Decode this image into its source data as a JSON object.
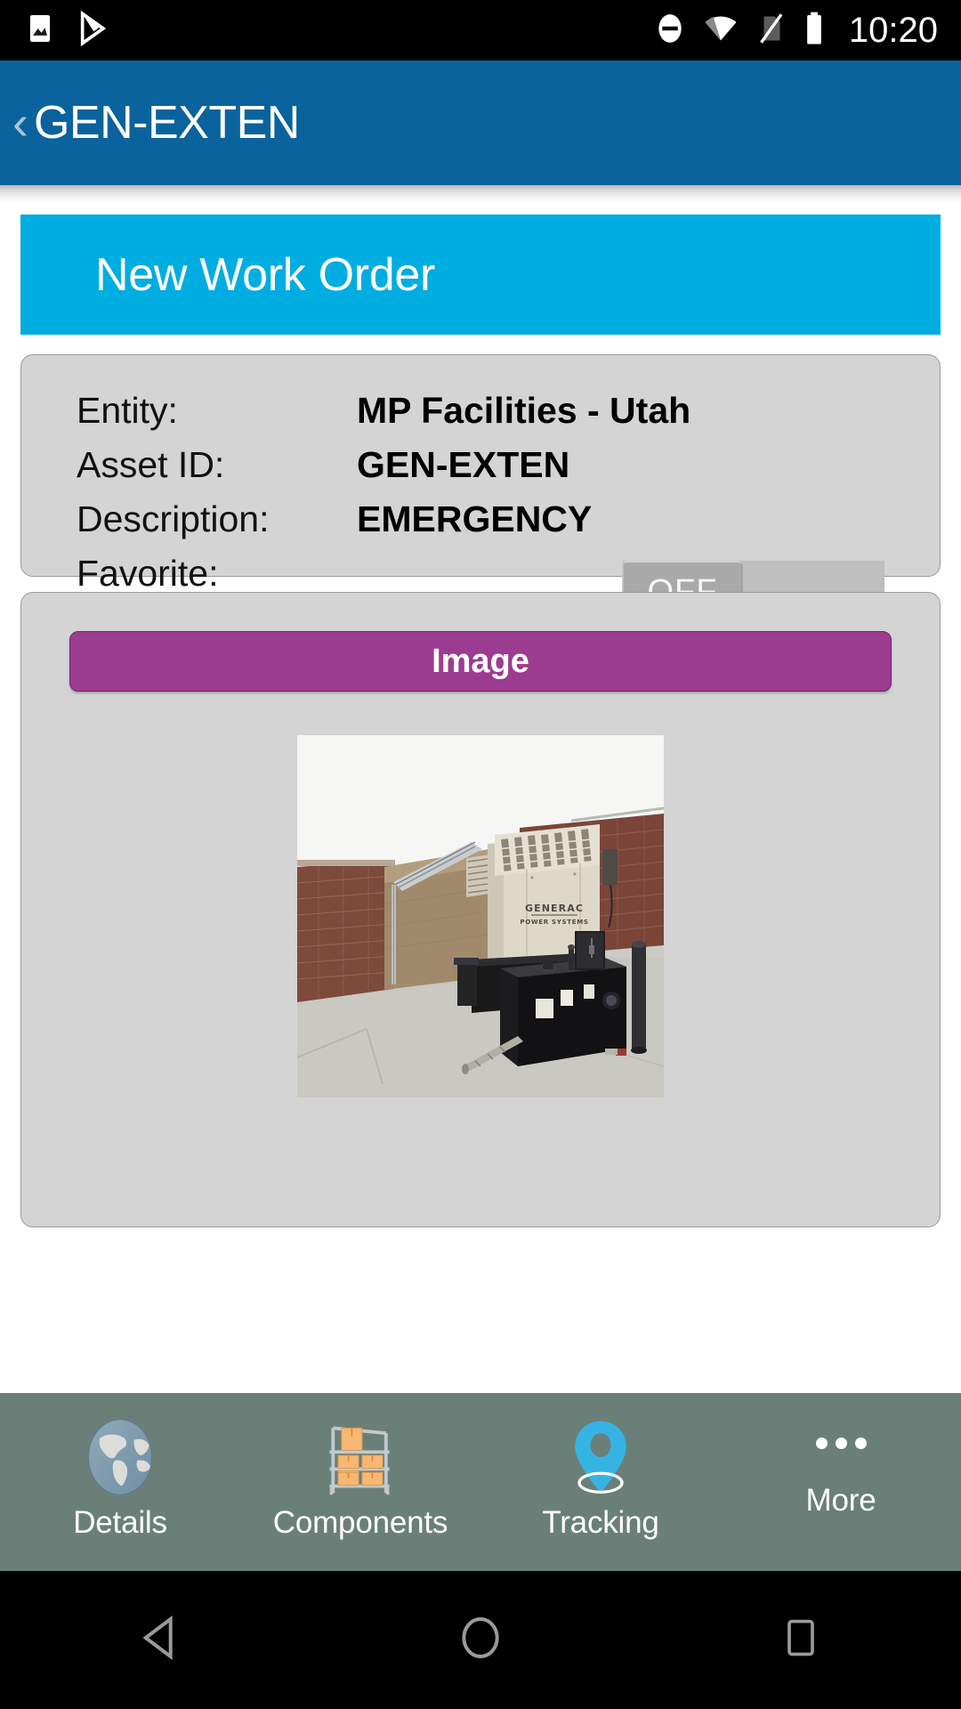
{
  "status_bar": {
    "clock": "10:20",
    "left_icons": [
      "gallery-icon",
      "play-store-icon"
    ],
    "right_icons": [
      "do-not-disturb-icon",
      "wifi-icon",
      "no-sim-icon",
      "battery-icon"
    ]
  },
  "app_bar": {
    "back_glyph": "‹",
    "title": "GEN-EXTEN",
    "background_color": "#0A639C"
  },
  "panel": {
    "title": "New Work Order",
    "background_color": "#00ADE1"
  },
  "info_card": {
    "rows": [
      {
        "label": "Entity:",
        "value": "MP Facilities - Utah"
      },
      {
        "label": "Asset ID:",
        "value": "GEN-EXTEN"
      },
      {
        "label": "Description:",
        "value": "EMERGENCY"
      }
    ],
    "favorite": {
      "label": "Favorite:",
      "state": "OFF"
    }
  },
  "image_card": {
    "button_label": "Image",
    "button_color": "#9C3C91",
    "photo_alt": "Generac Power Systems standby generator with black fuel tank base beside a brick wall"
  },
  "tab_bar": {
    "background_color": "#6B7F79",
    "tabs": [
      {
        "label": "Details",
        "icon": "globe-icon"
      },
      {
        "label": "Components",
        "icon": "warehouse-shelf-icon"
      },
      {
        "label": "Tracking",
        "icon": "map-pin-icon"
      },
      {
        "label": "More",
        "icon": "overflow-dots-icon"
      }
    ]
  },
  "nav_bar": {
    "buttons": [
      {
        "name": "back",
        "icon": "triangle-back-icon"
      },
      {
        "name": "home",
        "icon": "circle-home-icon"
      },
      {
        "name": "recents",
        "icon": "square-recents-icon"
      }
    ]
  }
}
